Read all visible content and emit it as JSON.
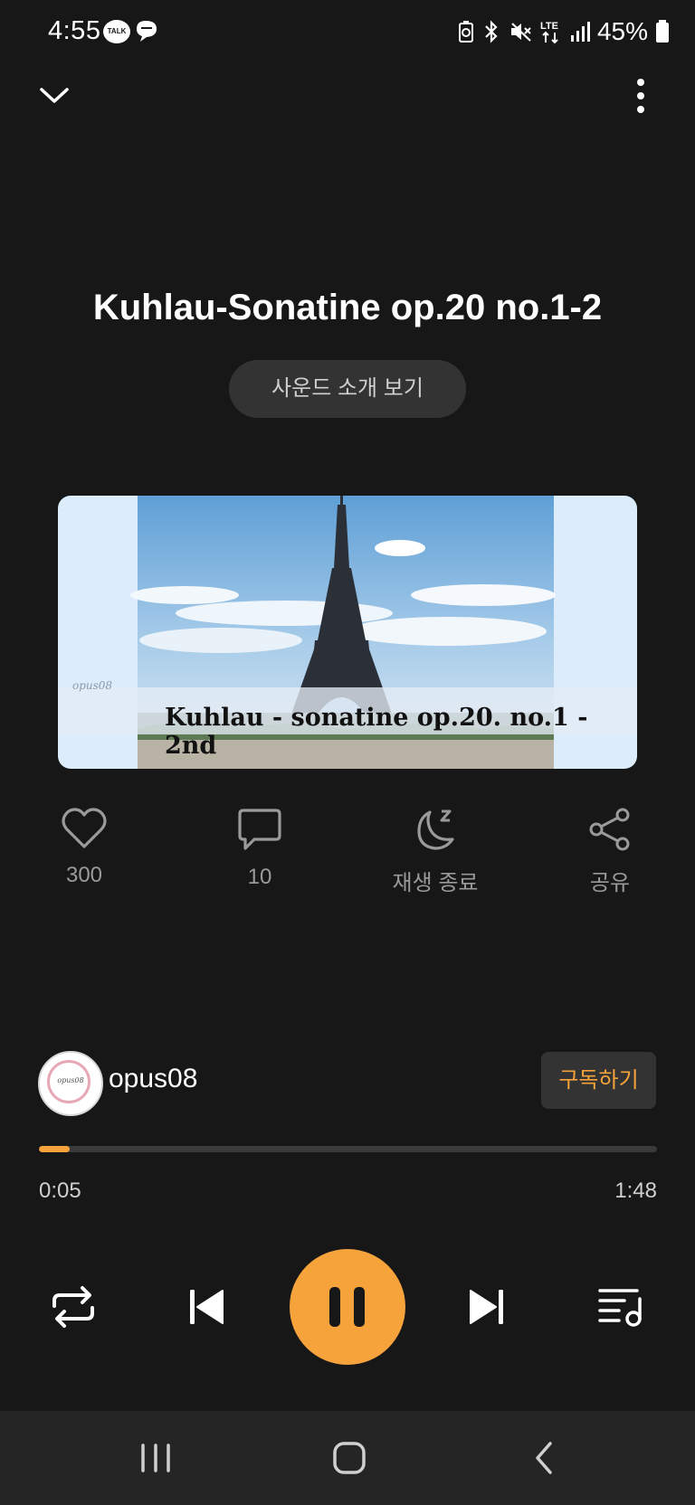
{
  "status_bar": {
    "time": "4:55",
    "talk_badge": "TALK",
    "network": "LTE",
    "battery": "45%"
  },
  "track": {
    "title": "Kuhlau-Sonatine op.20 no.1-2",
    "intro_button": "사운드 소개 보기"
  },
  "artwork": {
    "watermark": "opus08",
    "caption": "Kuhlau - sonatine op.20. no.1 - 2nd"
  },
  "actions": {
    "like_count": "300",
    "comment_count": "10",
    "sleep_label": "재생 종료",
    "share_label": "공유"
  },
  "channel": {
    "name": "opus08",
    "avatar_text": "opus08",
    "subscribe_label": "구독하기"
  },
  "playback": {
    "elapsed": "0:05",
    "total": "1:48",
    "progress_fraction": 0.05
  },
  "colors": {
    "accent": "#f6a33c",
    "background": "#171717"
  }
}
